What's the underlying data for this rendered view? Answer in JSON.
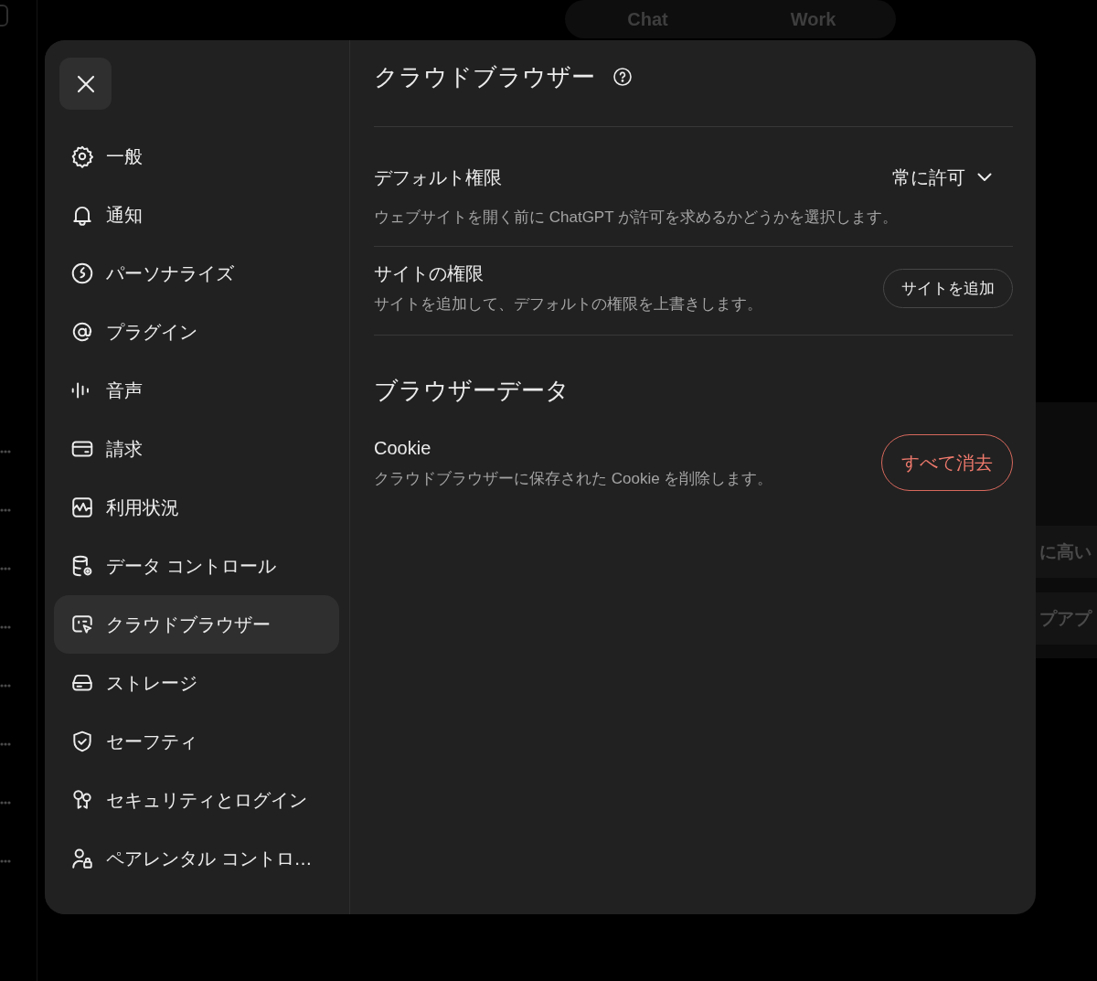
{
  "background": {
    "tabs": [
      {
        "label": "Chat"
      },
      {
        "label": "Work"
      }
    ],
    "panel_rows": [
      {
        "text": "に高い"
      },
      {
        "text": "プアプ"
      }
    ]
  },
  "settings_dialog": {
    "sidebar": {
      "items": [
        {
          "label": "一般",
          "selected": false
        },
        {
          "label": "通知",
          "selected": false
        },
        {
          "label": "パーソナライズ",
          "selected": false
        },
        {
          "label": "プラグイン",
          "selected": false
        },
        {
          "label": "音声",
          "selected": false
        },
        {
          "label": "請求",
          "selected": false
        },
        {
          "label": "利用状況",
          "selected": false
        },
        {
          "label": "データ コントロール",
          "selected": false
        },
        {
          "label": "クラウドブラウザー",
          "selected": true
        },
        {
          "label": "ストレージ",
          "selected": false
        },
        {
          "label": "セーフティ",
          "selected": false
        },
        {
          "label": "セキュリティとログイン",
          "selected": false
        },
        {
          "label": "ペアレンタル コントロ…",
          "selected": false
        }
      ]
    },
    "content": {
      "title": "クラウドブラウザー",
      "sections": [
        {
          "rows": [
            {
              "kind": "dropdown",
              "label": "デフォルト権限",
              "value": "常に許可",
              "description": "ウェブサイトを開く前に ChatGPT が許可を求めるかどうかを選択します。"
            },
            {
              "kind": "button",
              "label": "サイトの権限",
              "description": "サイトを追加して、デフォルトの権限を上書きします。",
              "action": "サイトを追加"
            }
          ]
        },
        {
          "heading": "ブラウザーデータ",
          "rows": [
            {
              "kind": "danger-button",
              "label": "Cookie",
              "description": "クラウドブラウザーに保存された Cookie を削除します。",
              "action": "すべて消去"
            }
          ]
        }
      ]
    }
  }
}
